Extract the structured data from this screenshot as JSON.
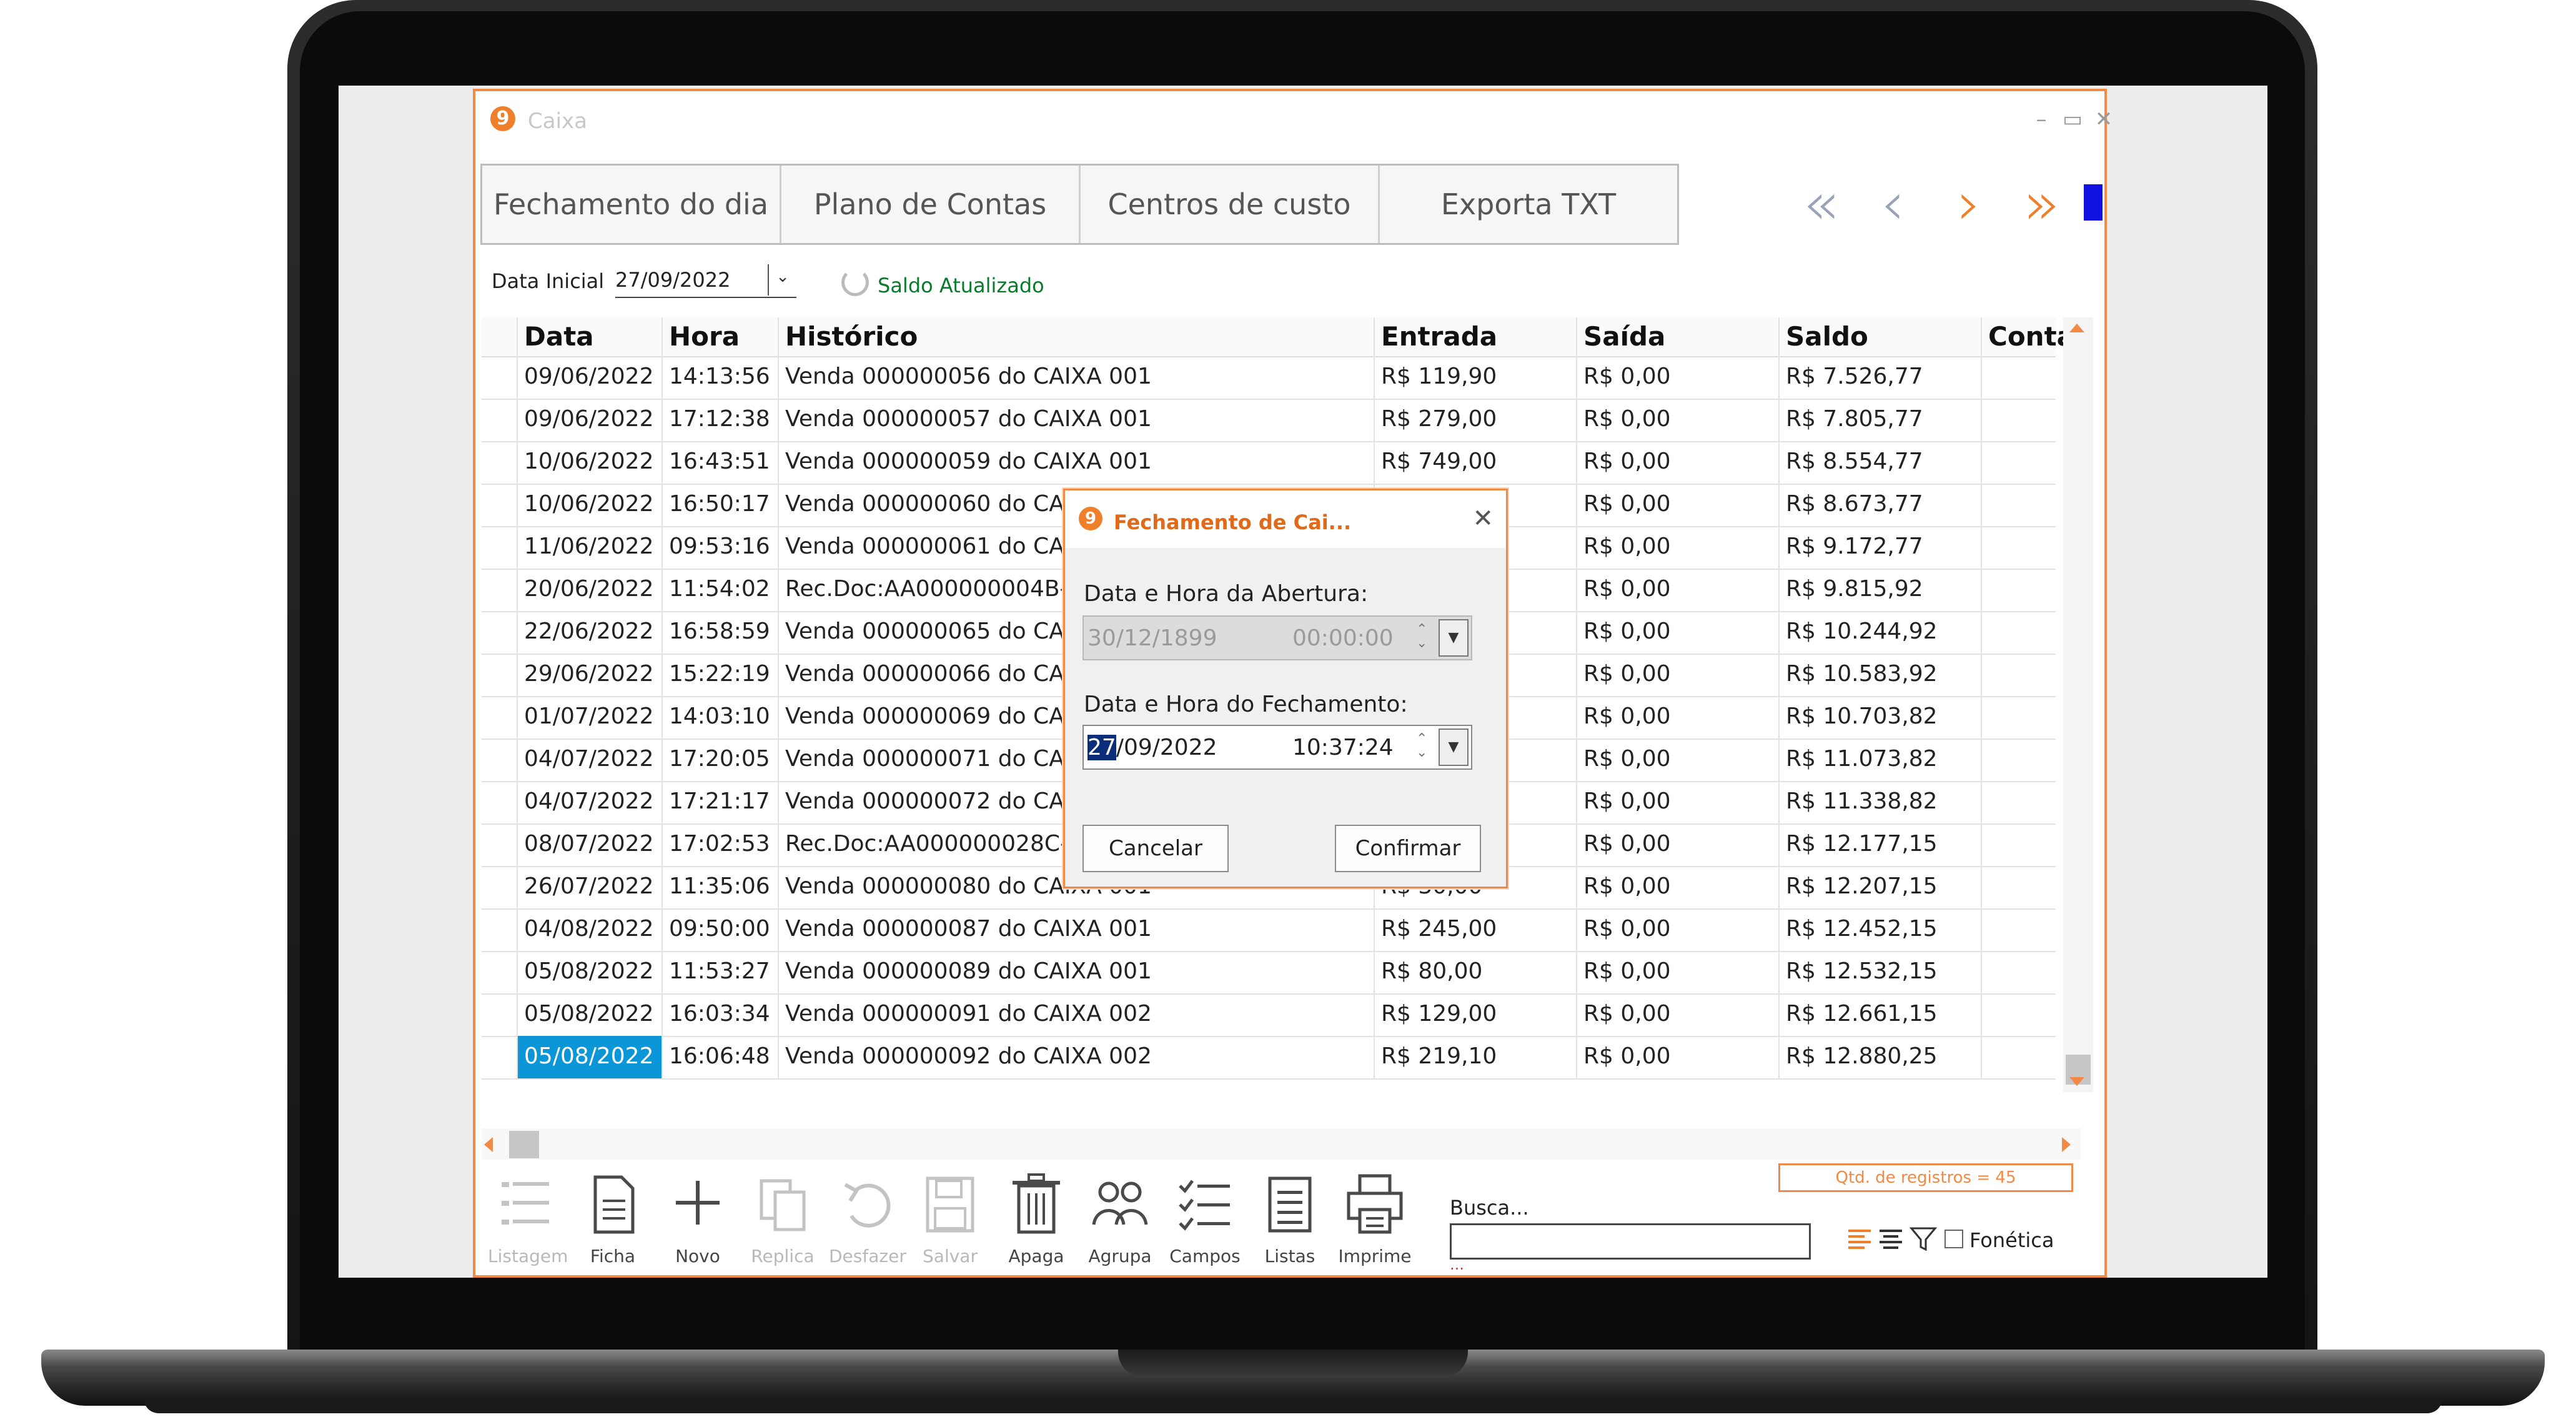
{
  "window": {
    "title": "Caixa"
  },
  "tabs": [
    "Fechamento do dia",
    "Plano de Contas",
    "Centros de custo",
    "Exporta TXT"
  ],
  "nav": {
    "first": "«",
    "prev": "‹",
    "next": "›",
    "last": "»"
  },
  "filter": {
    "label": "Data Inicial",
    "value": "27/09/2022",
    "status": "Saldo Atualizado"
  },
  "grid": {
    "columns": [
      "Data",
      "Hora",
      "Histórico",
      "Entrada",
      "Saída",
      "Saldo",
      "Conta"
    ],
    "rows": [
      [
        "09/06/2022",
        "14:13:56",
        "Venda 000000056 do CAIXA 001",
        "R$ 119,90",
        "R$ 0,00",
        "R$ 7.526,77",
        ""
      ],
      [
        "09/06/2022",
        "17:12:38",
        "Venda 000000057 do CAIXA 001",
        "R$ 279,00",
        "R$ 0,00",
        "R$ 7.805,77",
        ""
      ],
      [
        "10/06/2022",
        "16:43:51",
        "Venda 000000059 do CAIXA 001",
        "R$ 749,00",
        "R$ 0,00",
        "R$ 8.554,77",
        ""
      ],
      [
        "10/06/2022",
        "16:50:17",
        "Venda 000000060 do CAIXA",
        "",
        "R$ 0,00",
        "R$ 8.673,77",
        ""
      ],
      [
        "11/06/2022",
        "09:53:16",
        "Venda 000000061 do CAIXA",
        "",
        "R$ 0,00",
        "R$ 9.172,77",
        ""
      ],
      [
        "20/06/2022",
        "11:54:02",
        "Rec.Doc:AA000000004B-MA",
        "",
        "R$ 0,00",
        "R$ 9.815,92",
        ""
      ],
      [
        "22/06/2022",
        "16:58:59",
        "Venda 000000065 do CAIXA",
        "",
        "R$ 0,00",
        "R$ 10.244,92",
        ""
      ],
      [
        "29/06/2022",
        "15:22:19",
        "Venda 000000066 do CAIXA",
        "",
        "R$ 0,00",
        "R$ 10.583,92",
        ""
      ],
      [
        "01/07/2022",
        "14:03:10",
        "Venda 000000069 do CAIXA",
        "",
        "R$ 0,00",
        "R$ 10.703,82",
        ""
      ],
      [
        "04/07/2022",
        "17:20:05",
        "Venda 000000071 do CAIXA",
        "",
        "R$ 0,00",
        "R$ 11.073,82",
        ""
      ],
      [
        "04/07/2022",
        "17:21:17",
        "Venda 000000072 do CAIXA",
        "",
        "R$ 0,00",
        "R$ 11.338,82",
        ""
      ],
      [
        "08/07/2022",
        "17:02:53",
        "Rec.Doc:AA000000028C-AN",
        "",
        "R$ 0,00",
        "R$ 12.177,15",
        ""
      ],
      [
        "26/07/2022",
        "11:35:06",
        "Venda 000000080 do CAIXA 001",
        "R$ 30,00",
        "R$ 0,00",
        "R$ 12.207,15",
        ""
      ],
      [
        "04/08/2022",
        "09:50:00",
        "Venda 000000087 do CAIXA 001",
        "R$ 245,00",
        "R$ 0,00",
        "R$ 12.452,15",
        ""
      ],
      [
        "05/08/2022",
        "11:53:27",
        "Venda 000000089 do CAIXA 001",
        "R$ 80,00",
        "R$ 0,00",
        "R$ 12.532,15",
        ""
      ],
      [
        "05/08/2022",
        "16:03:34",
        "Venda 000000091 do CAIXA 002",
        "R$ 129,00",
        "R$ 0,00",
        "R$ 12.661,15",
        ""
      ],
      [
        "05/08/2022",
        "16:06:48",
        "Venda 000000092 do CAIXA 002",
        "R$ 219,10",
        "R$ 0,00",
        "R$ 12.880,25",
        ""
      ]
    ]
  },
  "toolbar": {
    "items": [
      {
        "label": "Listagem",
        "icon": "list-icon",
        "enabled": false
      },
      {
        "label": "Ficha",
        "icon": "document-icon",
        "enabled": true
      },
      {
        "label": "Novo",
        "icon": "plus-icon",
        "enabled": true
      },
      {
        "label": "Replica",
        "icon": "copy-icon",
        "enabled": false
      },
      {
        "label": "Desfazer",
        "icon": "undo-icon",
        "enabled": false
      },
      {
        "label": "Salvar",
        "icon": "save-icon",
        "enabled": false
      },
      {
        "label": "Apaga",
        "icon": "trash-icon",
        "enabled": true
      },
      {
        "label": "Agrupa",
        "icon": "group-icon",
        "enabled": true
      },
      {
        "label": "Campos",
        "icon": "checklist-icon",
        "enabled": true
      },
      {
        "label": "Listas",
        "icon": "lists-icon",
        "enabled": true
      },
      {
        "label": "Imprime",
        "icon": "printer-icon",
        "enabled": true
      }
    ],
    "busca_label": "Busca...",
    "busca_value": "",
    "busca_dots": "...",
    "qtd_registros": "Qtd. de registros = 45",
    "fonetica_label": "Fonética"
  },
  "modal": {
    "title": "Fechamento de Cai...",
    "abertura_label": "Data e Hora da Abertura:",
    "abertura_date": "30/12/1899",
    "abertura_time": "00:00:00",
    "fechamento_label": "Data e Hora do Fechamento:",
    "fechamento_date_sel": "27",
    "fechamento_date_rest": "/09/2022",
    "fechamento_time": "10:37:24",
    "cancel_label": "Cancelar",
    "confirm_label": "Confirmar"
  },
  "colors": {
    "accent": "#f08a46",
    "selection": "#0b96d8",
    "status_green": "#0a7a2c",
    "nav_blue": "#1010e0"
  }
}
